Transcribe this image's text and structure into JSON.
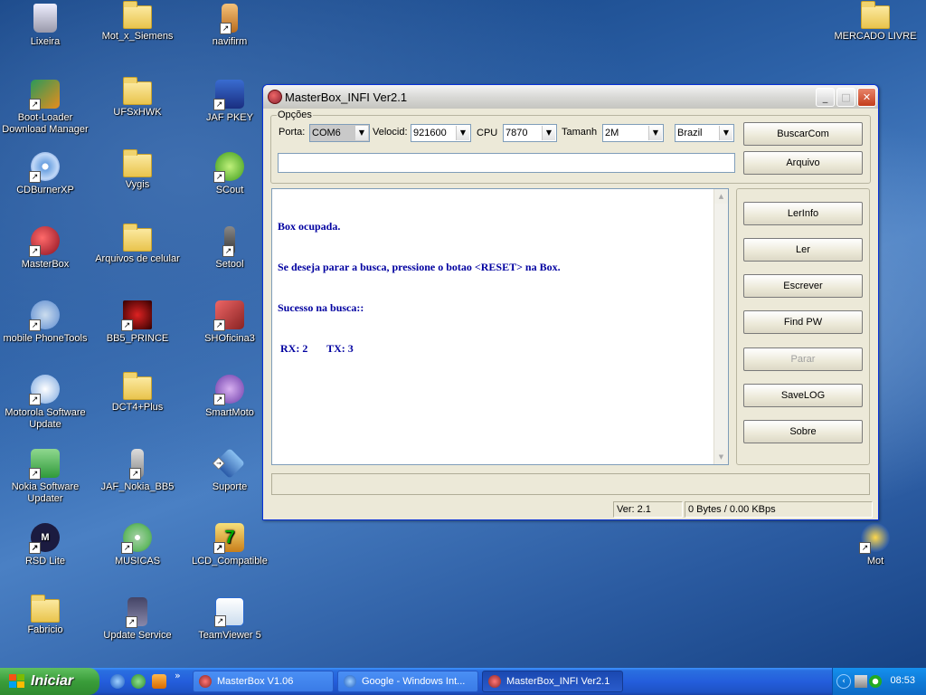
{
  "desktop": {
    "icons": [
      {
        "label": "Lixeira"
      },
      {
        "label": "Mot_x_Siemens"
      },
      {
        "label": "navifirm"
      },
      {
        "label": "MERCADO LIVRE"
      },
      {
        "label": "Boot-Loader Download Manager"
      },
      {
        "label": "UFSxHWK"
      },
      {
        "label": "JAF PKEY"
      },
      {
        "label": "CDBurnerXP"
      },
      {
        "label": "Vygis"
      },
      {
        "label": "SCout"
      },
      {
        "label": "MasterBox"
      },
      {
        "label": "Arquivos de celular"
      },
      {
        "label": "Setool"
      },
      {
        "label": "mobile PhoneTools"
      },
      {
        "label": "BB5_PRINCE"
      },
      {
        "label": "SHOficina3"
      },
      {
        "label": "Motorola Software Update"
      },
      {
        "label": "DCT4+Plus"
      },
      {
        "label": "SmartMoto"
      },
      {
        "label": "Nokia Software Updater"
      },
      {
        "label": "JAF_Nokia_BB5"
      },
      {
        "label": "Suporte"
      },
      {
        "label": "RSD Lite"
      },
      {
        "label": "MUSICAS"
      },
      {
        "label": "LCD_Compatible"
      },
      {
        "label": "Mot"
      },
      {
        "label": "Fabricio"
      },
      {
        "label": "Update Service"
      },
      {
        "label": "TeamViewer 5"
      }
    ]
  },
  "window": {
    "title": "MasterBox_INFI Ver2.1",
    "minimize": "_",
    "maximize": "□",
    "close": "✕",
    "options_group": "Opções",
    "port_label": "Porta:",
    "port_value": "COM6",
    "speed_label": "Velocid:",
    "speed_value": "921600",
    "cpu_label": "CPU",
    "cpu_value": "7870",
    "size_label": "Tamanh",
    "size_value": "2M",
    "region_value": "Brazil",
    "buttons": {
      "buscarcom": "BuscarCom",
      "arquivo": "Arquivo",
      "lerinfo": "LerInfo",
      "ler": "Ler",
      "escrever": "Escrever",
      "findpw": "Find PW",
      "parar": "Parar",
      "savelog": "SaveLOG",
      "sobre": "Sobre"
    },
    "file_path": "",
    "log": [
      "Box ocupada.",
      "Se deseja parar a busca, pressione o botao <RESET> na Box.",
      "Sucesso na busca::",
      " RX: 2       TX: 3"
    ],
    "status_version": "Ver: 2.1",
    "status_transfer": "0 Bytes / 0.00 KBps"
  },
  "taskbar": {
    "start_label": "Iniciar",
    "tasks": [
      {
        "label": "MasterBox V1.06"
      },
      {
        "label": "Google - Windows Int..."
      },
      {
        "label": "MasterBox_INFI Ver2.1"
      }
    ],
    "clock": "08:53"
  },
  "colors": {
    "log_text": "#0000a0",
    "taskbar": "#245edc",
    "start_button": "#3a9d3a"
  }
}
